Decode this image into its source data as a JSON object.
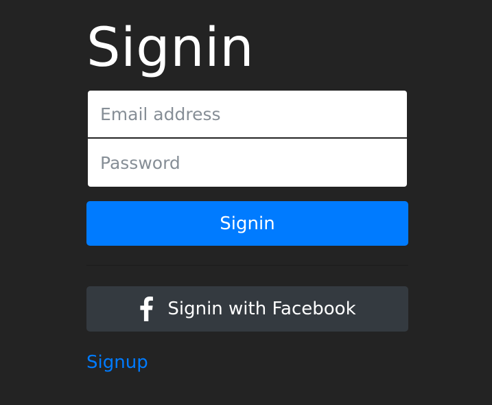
{
  "page": {
    "title": "Signin"
  },
  "form": {
    "email_placeholder": "Email address",
    "email_value": "",
    "password_placeholder": "Password",
    "password_value": "",
    "submit_label": "Signin",
    "facebook_label": "Signin with Facebook",
    "facebook_icon": "facebook-icon",
    "signup_label": "Signup"
  },
  "colors": {
    "background": "#232323",
    "primary": "#007bff",
    "facebook_button": "#343a40",
    "title_text": "#ffffff",
    "placeholder_text": "#868e96"
  }
}
